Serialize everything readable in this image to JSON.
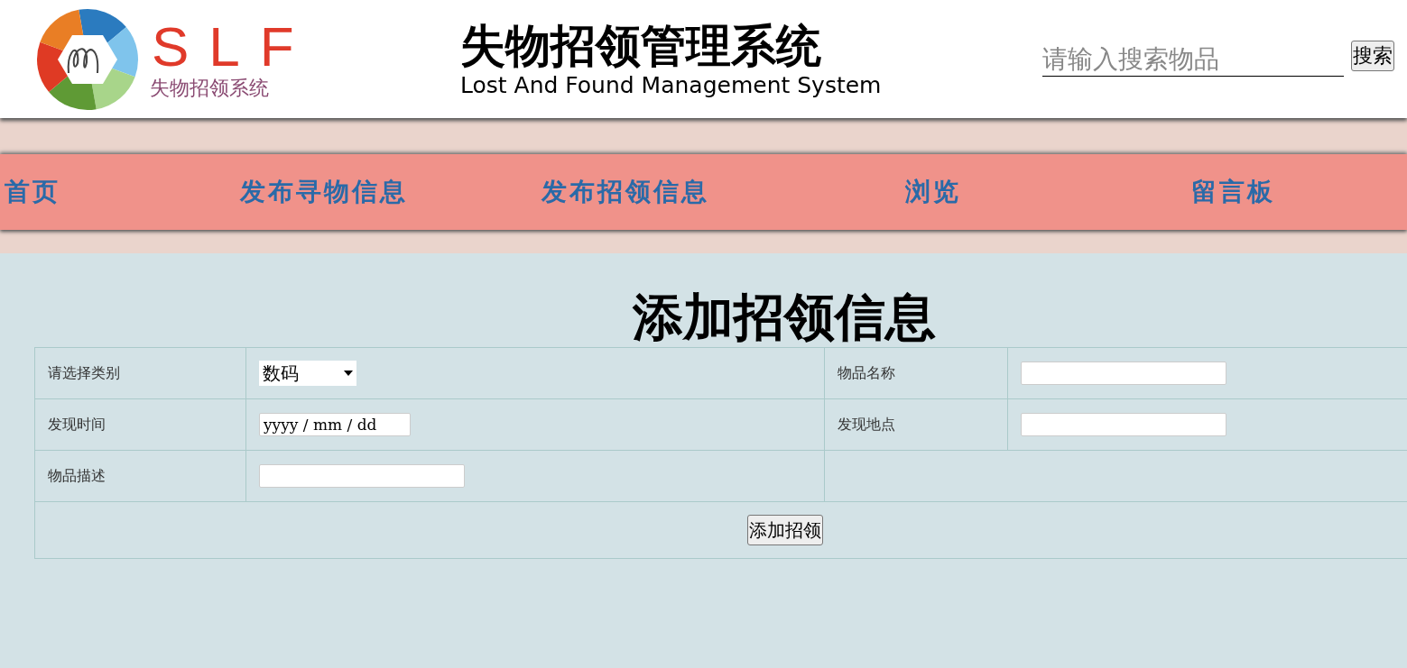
{
  "header": {
    "logo": {
      "title": "SLF",
      "subtitle": "失物招领系统"
    },
    "title": "失物招领管理系统",
    "subtitle": "Lost And Found Management System",
    "search": {
      "placeholder": "请输入搜索物品",
      "button": "搜索"
    }
  },
  "nav": [
    {
      "label": "首页"
    },
    {
      "label": "发布寻物信息"
    },
    {
      "label": "发布招领信息"
    },
    {
      "label": "浏览"
    },
    {
      "label": "留言板"
    }
  ],
  "form": {
    "heading": "添加招领信息",
    "rows": [
      {
        "cells": [
          {
            "kind": "label",
            "text": "请选择类别"
          },
          {
            "kind": "select",
            "value": "数码"
          },
          {
            "kind": "label",
            "text": "物品名称"
          },
          {
            "kind": "input"
          }
        ]
      },
      {
        "cells": [
          {
            "kind": "label",
            "text": "发现时间"
          },
          {
            "kind": "date",
            "placeholder": "yyyy / mm / dd"
          },
          {
            "kind": "label",
            "text": "发现地点"
          },
          {
            "kind": "input"
          }
        ]
      },
      {
        "cells": [
          {
            "kind": "label",
            "text": "物品描述"
          },
          {
            "kind": "wide-input"
          },
          {
            "kind": "empty"
          }
        ]
      }
    ],
    "submit": "添加招领"
  }
}
